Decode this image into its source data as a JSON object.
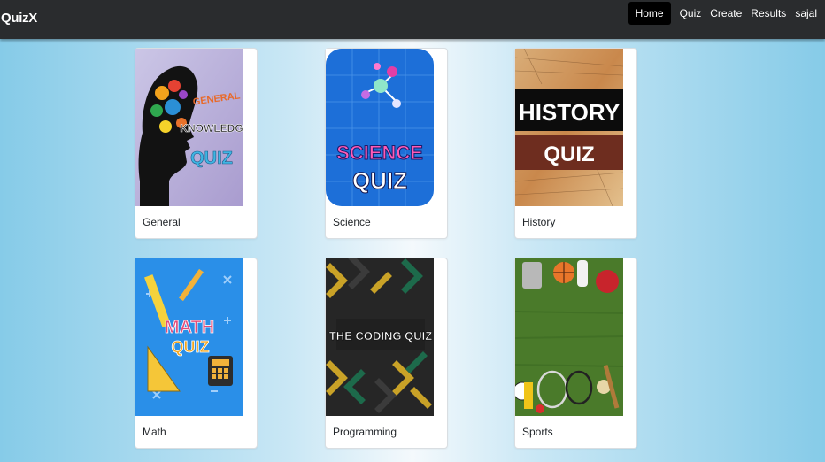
{
  "navbar": {
    "brand": "QuizX",
    "links": [
      "Home",
      "Quiz",
      "Create",
      "Results",
      "sajal"
    ]
  },
  "cards": [
    {
      "title": "General",
      "image_text": [
        "GENERAL",
        "KNOWLEDGE",
        "QUIZ"
      ]
    },
    {
      "title": "Science",
      "image_text": [
        "SCIENCE",
        "QUIZ"
      ]
    },
    {
      "title": "History",
      "image_text": [
        "HISTORY",
        "QUIZ"
      ]
    },
    {
      "title": "Math",
      "image_text": [
        "MATH",
        "QUIZ"
      ]
    },
    {
      "title": "Programming",
      "image_text": [
        "THE CODING QUIZ"
      ]
    },
    {
      "title": "Sports",
      "image_text": []
    }
  ]
}
